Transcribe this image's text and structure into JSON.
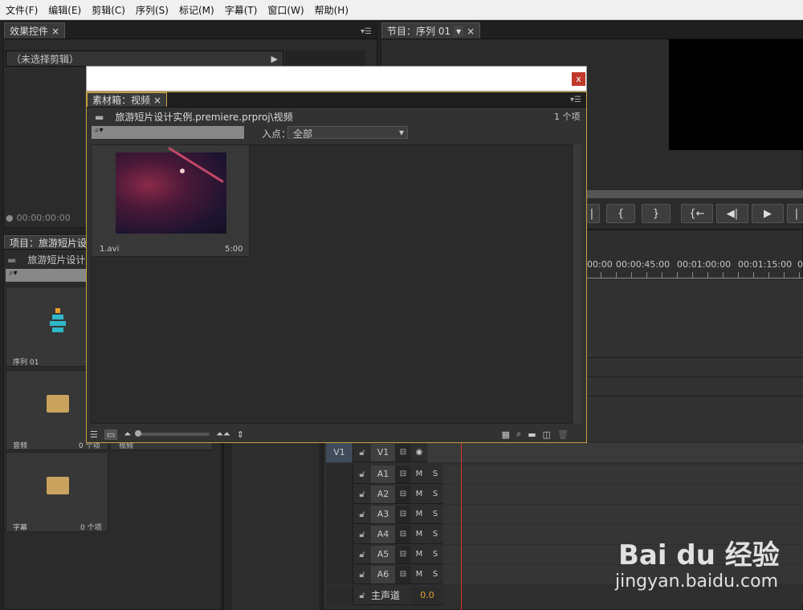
{
  "menu": [
    "文件(F)",
    "编辑(E)",
    "剪辑(C)",
    "序列(S)",
    "标记(M)",
    "字幕(T)",
    "窗口(W)",
    "帮助(H)"
  ],
  "effects": {
    "tab": "效果控件",
    "no_clip": "（未选择剪辑）",
    "timecode": "00:00:00:00"
  },
  "program": {
    "tab": "节目：序列 01"
  },
  "project": {
    "tab": "项目：旅游短片设",
    "path": "旅游短片设计",
    "items": [
      {
        "name": "序列 01",
        "count": ""
      },
      {
        "name": "音频",
        "count": "0 个项"
      },
      {
        "name": "字幕",
        "count": "0 个项"
      }
    ],
    "partial_label": "视频"
  },
  "bin": {
    "tab": "素材箱：视频",
    "path": "旅游短片设计实例.premiere.prproj\\视频",
    "count": "1 个项",
    "inpoint_label": "入点：",
    "inpoint_value": "全部",
    "clip": {
      "name": "1.avi",
      "duration": "5:00"
    }
  },
  "dialog": {
    "close": "x"
  },
  "timeline": {
    "ruler": [
      "00:00",
      "00:00:45:00",
      "00:01:00:00",
      "00:01:15:00",
      "00"
    ],
    "tracks": [
      {
        "name": "V1",
        "src": "V1",
        "kind": "video"
      },
      {
        "name": "A1",
        "kind": "audio"
      },
      {
        "name": "A2",
        "kind": "audio"
      },
      {
        "name": "A3",
        "kind": "audio"
      },
      {
        "name": "A4",
        "kind": "audio"
      },
      {
        "name": "A5",
        "kind": "audio"
      },
      {
        "name": "A6",
        "kind": "audio"
      }
    ],
    "master": {
      "label": "主声道",
      "value": "0.0"
    }
  },
  "watermark": {
    "brand": "Bai du 经验",
    "url": "jingyan.baidu.com"
  },
  "colors": {
    "accent_gold": "#c8a040",
    "playhead": "#e03030",
    "folder": "#c9a35e",
    "close_red": "#c0392b"
  }
}
